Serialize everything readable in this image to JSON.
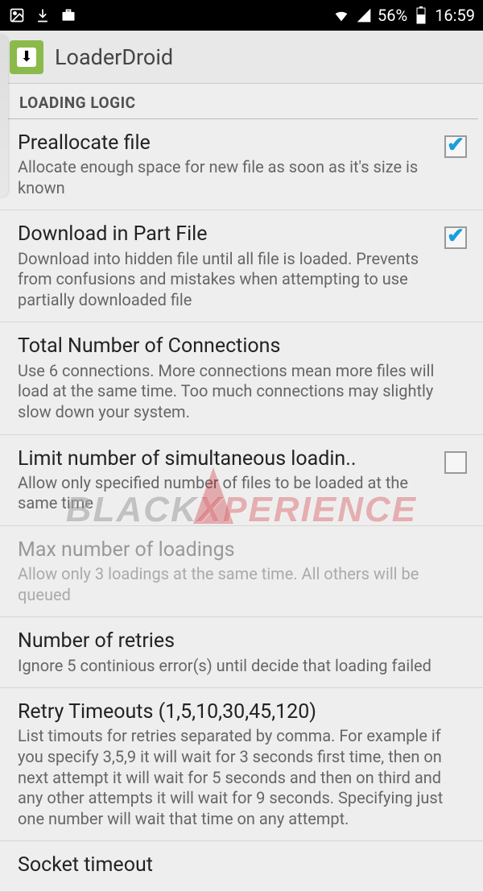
{
  "status": {
    "battery_pct": "56%",
    "time": "16:59"
  },
  "app": {
    "title": "LoaderDroid"
  },
  "section": {
    "loading_logic": "LOADING LOGIC"
  },
  "settings": [
    {
      "key": "preallocate",
      "title": "Preallocate file",
      "summary": "Allocate enough space for new file as soon as it's size is known",
      "type": "checkbox",
      "checked": true,
      "enabled": true
    },
    {
      "key": "download_part",
      "title": "Download in Part File",
      "summary": "Download into hidden file until all file is loaded. Prevents from confusions and mistakes when attempting to use partially downloaded file",
      "type": "checkbox",
      "checked": true,
      "enabled": true
    },
    {
      "key": "total_connections",
      "title": "Total Number of Connections",
      "summary": "Use 6 connections. More connections mean more files will load at the same time. Too much connections may slightly slow down your system.",
      "type": "link",
      "enabled": true
    },
    {
      "key": "limit_simultaneous",
      "title": "Limit number of simultaneous loadin..",
      "summary": "Allow only specified number of files to be loaded at the same time",
      "type": "checkbox",
      "checked": false,
      "enabled": true
    },
    {
      "key": "max_loadings",
      "title": "Max number of loadings",
      "summary": "Allow only 3 loadings at the same time. All others will be queued",
      "type": "link",
      "enabled": false
    },
    {
      "key": "num_retries",
      "title": "Number of retries",
      "summary": "Ignore 5 continious error(s) until decide that loading failed",
      "type": "link",
      "enabled": true
    },
    {
      "key": "retry_timeouts",
      "title": "Retry Timeouts (1,5,10,30,45,120)",
      "summary": "List timouts for retries separated by comma. For example if you specify 3,5,9 it will wait for 3 seconds first time, then on next attempt it will wait for 5 seconds and then on third and any other attempts it will wait for 9 seconds. Specifying just one number will wait that time on any attempt.",
      "type": "link",
      "enabled": true
    },
    {
      "key": "socket_timeout",
      "title": "Socket timeout",
      "summary": "",
      "type": "link",
      "enabled": true
    }
  ],
  "watermark": "BLACKXPERIENCE"
}
